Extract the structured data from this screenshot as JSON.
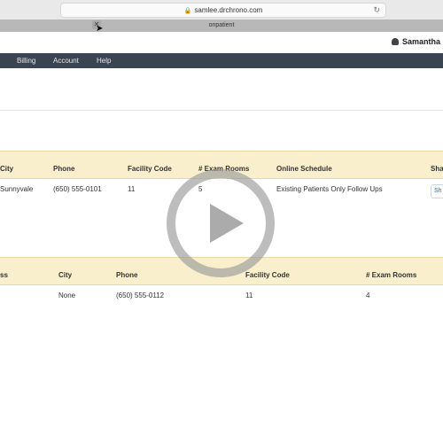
{
  "browser": {
    "url": "samlee.drchrono.com",
    "tab_title": "onpatient",
    "tab_close": "✕",
    "reload": "↻",
    "lock": "🔒"
  },
  "header": {
    "user_name": "Samantha L"
  },
  "nav": {
    "items": [
      "Billing",
      "Account",
      "Help"
    ]
  },
  "table1": {
    "headers": [
      "City",
      "Phone",
      "Facility Code",
      "# Exam Rooms",
      "Online Schedule",
      "Sha"
    ],
    "row": {
      "city": "Sunnyvale",
      "phone": "(650) 555-0101",
      "facility_code": "11",
      "exam_rooms": "5",
      "online_schedule": "Existing Patients Only Follow Ups",
      "share_button": "Sh"
    }
  },
  "table2": {
    "headers": [
      "ss",
      "City",
      "Phone",
      "Facility Code",
      "# Exam Rooms"
    ],
    "row": {
      "city": "None",
      "phone": "(650) 555-0112",
      "facility_code": "11",
      "exam_rooms": "4"
    }
  },
  "overlay": {
    "icon": "play-icon",
    "color": "#ffffff"
  }
}
